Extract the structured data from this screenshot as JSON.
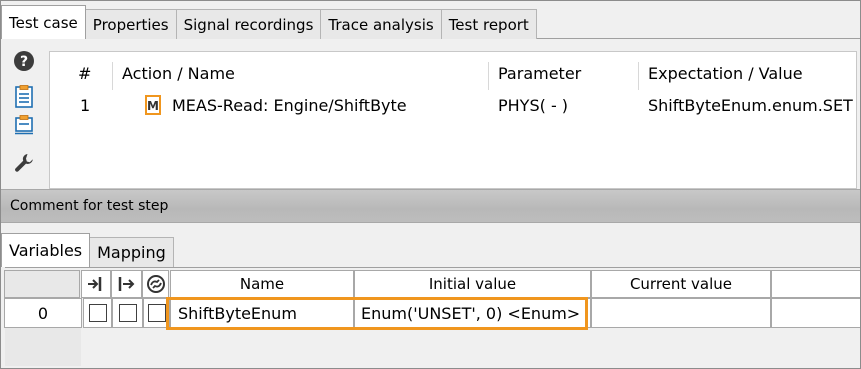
{
  "top_tabs": [
    "Test case",
    "Properties",
    "Signal recordings",
    "Trace analysis",
    "Test report"
  ],
  "active_top_tab": "Test case",
  "toolbar_icons": [
    "help-icon",
    "test-step-list-icon",
    "test-step-detail-icon",
    "wrench-icon"
  ],
  "steps_table": {
    "headers": {
      "num": "#",
      "action": "Action / Name",
      "parameter": "Parameter",
      "expectation": "Expectation / Value"
    },
    "rows": [
      {
        "num": "1",
        "badge": "M",
        "action": "MEAS-Read: Engine/ShiftByte",
        "parameter": "PHYS( - )",
        "expectation": "ShiftByteEnum.enum.SET"
      }
    ]
  },
  "comment_label": "Comment for test step",
  "bottom_tabs": [
    "Variables",
    "Mapping"
  ],
  "active_bottom_tab": "Variables",
  "variables_table": {
    "header_icons": [
      "input-arrow-icon",
      "output-arrow-icon",
      "sync-icon"
    ],
    "headers": {
      "name": "Name",
      "initial": "Initial value",
      "current": "Current value"
    },
    "rows": [
      {
        "index": "0",
        "name": "ShiftByteEnum",
        "initial": "Enum('UNSET', 0) <Enum>",
        "current": ""
      }
    ]
  },
  "colors": {
    "highlight": "#f0961e",
    "badge_orange": "#f0961e",
    "icon_blue": "#1f6fb2"
  }
}
